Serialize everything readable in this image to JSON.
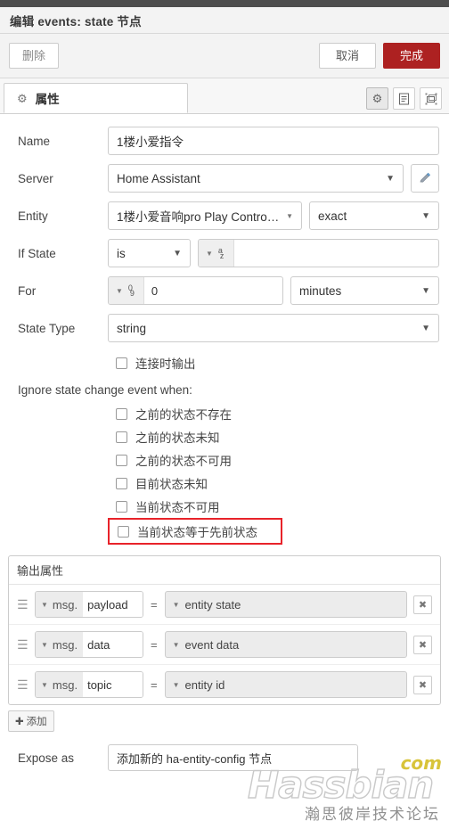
{
  "header": {
    "title": "编辑 events: state 节点"
  },
  "actions": {
    "delete_label": "删除",
    "cancel_label": "取消",
    "done_label": "完成",
    "done_color": "#ad2121"
  },
  "tabs": [
    {
      "label": "属性",
      "icon": "gear-icon",
      "active": true
    }
  ],
  "tab_tools": [
    {
      "name": "gear-icon",
      "active": true
    },
    {
      "name": "description-icon",
      "active": false
    },
    {
      "name": "node-appearance-icon",
      "active": false
    }
  ],
  "form": {
    "name": {
      "label": "Name",
      "value": "1楼小爱指令",
      "placeholder": "Name"
    },
    "server": {
      "label": "Server",
      "value": "Home Assistant",
      "edit_icon": "pencil-icon"
    },
    "entity": {
      "label": "Entity",
      "value": "1楼小爱音响pro Play Contro…",
      "match": "exact"
    },
    "if_state": {
      "label": "If State",
      "operator": "is",
      "type_icon": "az-string-icon",
      "value": ""
    },
    "for": {
      "label": "For",
      "type_icon": "09-number-icon",
      "value": "0",
      "unit": "minutes"
    },
    "state_type": {
      "label": "State Type",
      "value": "string"
    },
    "output_on_connect": {
      "label": "连接时输出",
      "checked": false
    }
  },
  "ignore_section": {
    "title": "Ignore state change event when:",
    "items": [
      {
        "label": "之前的状态不存在",
        "checked": false,
        "highlighted": false
      },
      {
        "label": "之前的状态未知",
        "checked": false,
        "highlighted": false
      },
      {
        "label": "之前的状态不可用",
        "checked": false,
        "highlighted": false
      },
      {
        "label": "目前状态未知",
        "checked": false,
        "highlighted": false
      },
      {
        "label": "当前状态不可用",
        "checked": false,
        "highlighted": false
      },
      {
        "label": "当前状态等于先前状态",
        "checked": false,
        "highlighted": true
      }
    ],
    "highlight_color": "#e8232a"
  },
  "output_properties": {
    "title": "输出属性",
    "eq": "=",
    "rows": [
      {
        "prefix": "msg.",
        "key": "payload",
        "value": "entity state"
      },
      {
        "prefix": "msg.",
        "key": "data",
        "value": "event data"
      },
      {
        "prefix": "msg.",
        "key": "topic",
        "value": "entity id"
      }
    ],
    "add_label": "添加",
    "add_icon": "plus-icon",
    "remove_icon": "close-icon"
  },
  "expose": {
    "label": "Expose as",
    "value": "添加新的 ha-entity-config 节点"
  },
  "watermark": {
    "main": "Hassbian",
    "tld": "com",
    "subtitle": "瀚思彼岸技术论坛"
  }
}
